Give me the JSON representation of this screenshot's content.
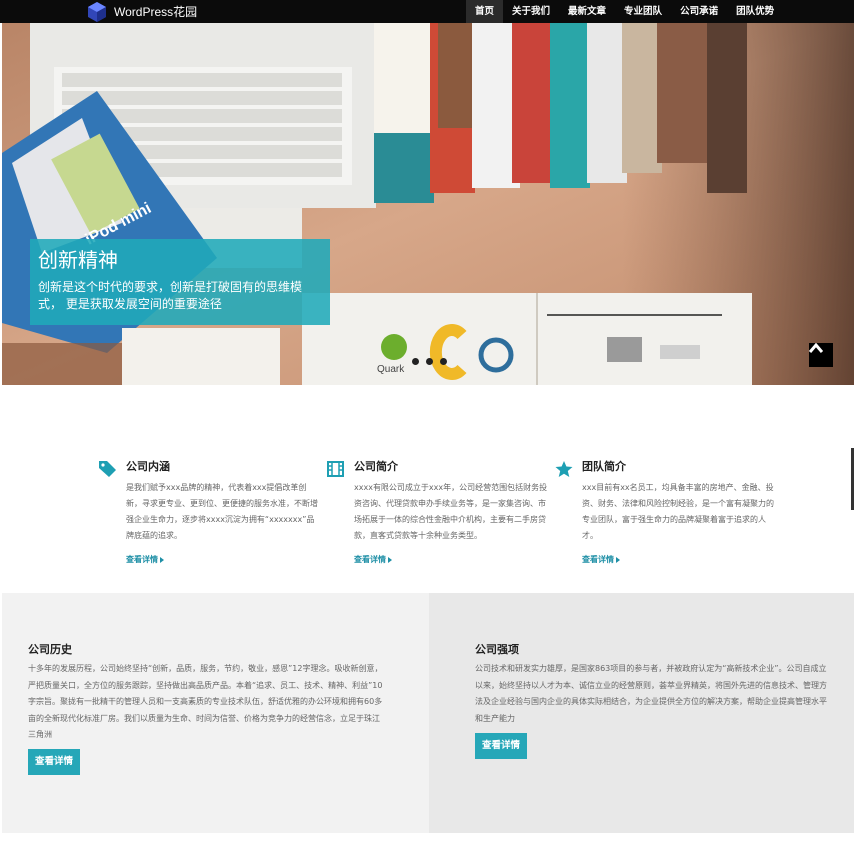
{
  "brand": {
    "name": "WordPress花园"
  },
  "nav": {
    "items": [
      {
        "label": "首页",
        "active": true
      },
      {
        "label": "关于我们"
      },
      {
        "label": "最新文章"
      },
      {
        "label": "专业团队"
      },
      {
        "label": "公司承诺"
      },
      {
        "label": "团队优势"
      }
    ]
  },
  "hero": {
    "title": "创新精神",
    "text": "创新是这个时代的要求，创新是打破固有的思维模式， 更是获取发展空间的重要途径",
    "slides": 3,
    "active_slide": 0,
    "image_text": {
      "ipod": "iPod mini",
      "quark": "Quark"
    }
  },
  "features": [
    {
      "icon": "tag-icon",
      "title": "公司内涵",
      "text": "是我们赋予xxx品牌的精神，代表着xxx提倡改革创新，寻求更专业、更到位、更便捷的服务水准，不断增强企业生命力，逐步将xxxx沉淀为拥有“xxxxxxx”品牌底蕴的追求。",
      "link": "查看详情"
    },
    {
      "icon": "film-icon",
      "title": "公司简介",
      "text": "xxxx有限公司成立于xxx年，公司经营范围包括财务投资咨询、代理贷款申办手续业务等，是一家集咨询、市场拓展于一体的综合性金融中介机构，主要有二手房贷款，直客式贷款等十余种业务类型。",
      "link": "查看详情"
    },
    {
      "icon": "star-icon",
      "title": "团队简介",
      "text": "xxx目前有xx名员工，均具备丰富的房地产、金融、投资、财务、法律和风险控制经验，是一个富有凝聚力的专业团队，富于强生命力的品牌凝聚着富于追求的人才。",
      "link": "查看详情"
    }
  ],
  "panels": {
    "history": {
      "title": "公司历史",
      "text": "十多年的发展历程，公司始终坚持“创新，品质，服务，节约，敬业，感恩”12字理念。吸收新创意，严把质量关口，全方位的服务跟踪，坚持做出高品质产品。本着“追求、员工、技术、精神、利益”10字宗旨。聚拢有一批精干的管理人员和一支高素质的专业技术队伍，舒适优雅的办公环境和拥有60多亩的全新现代化标准厂房。我们以质量为生命、时间为信誉、价格为竞争力的经营信念，立足于珠江三角洲",
      "button": "查看详情"
    },
    "strengths": {
      "title": "公司强项",
      "text": "公司技术和研发实力雄厚，是国家863项目的参与者，并被政府认定为“高新技术企业”。公司自成立以来，始终坚持以人才为本、诚信立业的经营原则，荟萃业界精英，将国外先进的信息技术、管理方法及企业经验与国内企业的具体实际相结合，为企业提供全方位的解决方案，帮助企业提高管理水平和生产能力",
      "button": "查看详情"
    }
  },
  "colors": {
    "accent": "#26a7b8",
    "nav_bg": "#0b0b0b",
    "link": "#1e8fa6"
  }
}
